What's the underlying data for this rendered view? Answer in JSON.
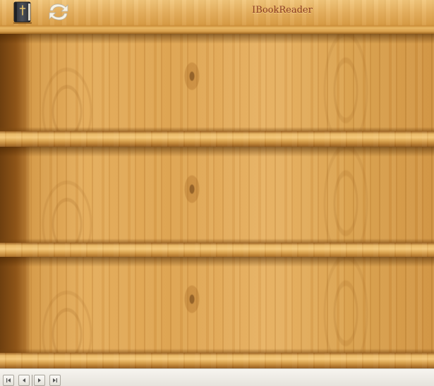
{
  "toolbar": {
    "title": "IBookReader",
    "buttons": [
      {
        "name": "bookshelf-book-icon",
        "tooltip": ""
      },
      {
        "name": "refresh-icon",
        "tooltip": ""
      }
    ]
  },
  "shelves": {
    "count": 3,
    "rows": [
      {
        "books": []
      },
      {
        "books": []
      },
      {
        "books": []
      }
    ]
  },
  "navigation": {
    "buttons": [
      {
        "name": "first-page-icon"
      },
      {
        "name": "previous-page-icon"
      },
      {
        "name": "next-page-icon"
      },
      {
        "name": "last-page-icon"
      }
    ]
  },
  "colors": {
    "title_text": "#8a3a1c",
    "wood_light": "#e6b062",
    "wood_dark": "#8e561b"
  }
}
